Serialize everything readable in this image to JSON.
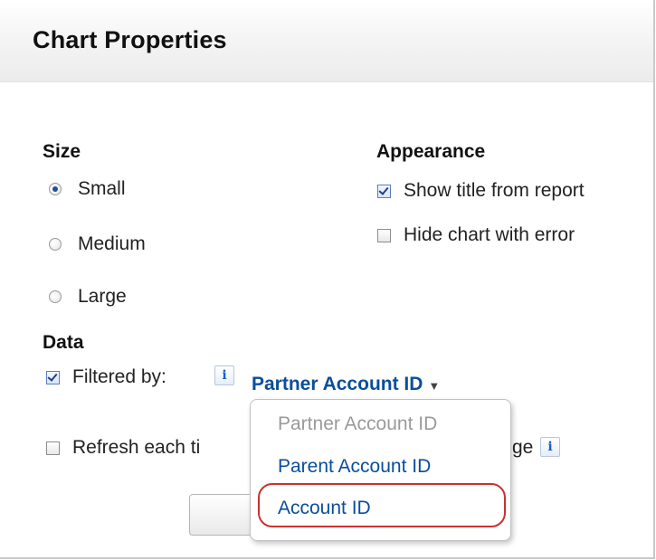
{
  "dialog": {
    "title": "Chart Properties"
  },
  "size": {
    "heading": "Size",
    "options": [
      {
        "label": "Small",
        "selected": true
      },
      {
        "label": "Medium",
        "selected": false
      },
      {
        "label": "Large",
        "selected": false
      }
    ]
  },
  "appearance": {
    "heading": "Appearance",
    "options": [
      {
        "label": "Show title from report",
        "checked": true
      },
      {
        "label": "Hide chart with error",
        "checked": false
      }
    ]
  },
  "data_section": {
    "heading": "Data",
    "filtered_by": {
      "label": "Filtered by:",
      "checked": true,
      "info_icon": "i",
      "selected_value": "Partner Account ID",
      "caret": "▼"
    },
    "refresh": {
      "label_left": "Refresh each ti",
      "label_right": "ge",
      "checked": false,
      "info_icon": "i"
    }
  },
  "dropdown": {
    "options": [
      {
        "label": "Partner Account ID",
        "state": "disabled"
      },
      {
        "label": "Parent Account ID",
        "state": "enabled"
      },
      {
        "label": "Account ID",
        "state": "highlighted"
      }
    ]
  },
  "colors": {
    "link_blue": "#0a4e9b",
    "highlight_red": "#c9322e",
    "disabled_gray": "#9a9a9a"
  }
}
